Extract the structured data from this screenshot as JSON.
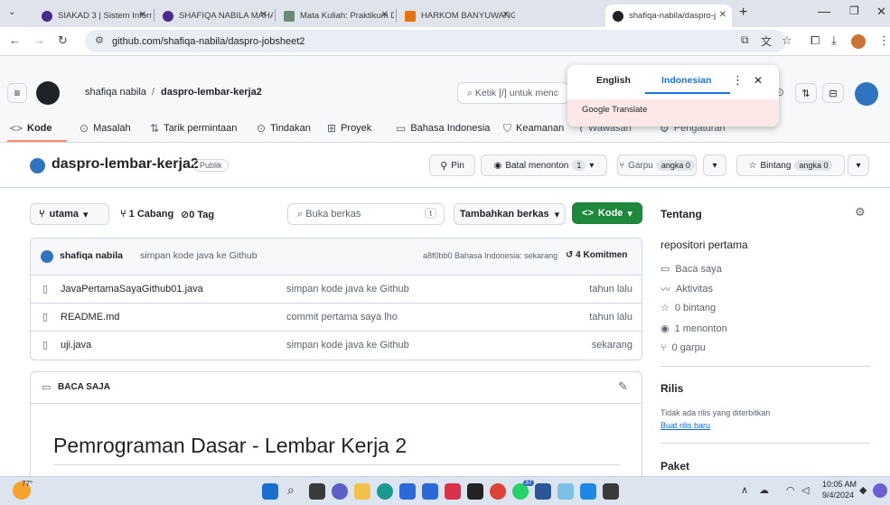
{
  "browser": {
    "tabs": [
      {
        "title": "SIAKAD 3 | Sistem Inform",
        "color": "#4a2a8a"
      },
      {
        "title": "SHAFIQA NABILA MAHA",
        "color": "#4a2a8a"
      },
      {
        "title": "Mata Kuliah: Praktikum D",
        "color": "#6d8b74"
      },
      {
        "title": "HARKOM BANYUWANGI",
        "color": "#e8710a"
      },
      {
        "title": "shafiqa-nabila/daspro-jo",
        "color": "#1f2328"
      }
    ],
    "url": "github.com/shafiqa-nabila/daspro-jobsheet2"
  },
  "translate": {
    "tab_english": "English",
    "tab_indonesian": "Indonesian",
    "footer": "Google Translate"
  },
  "header": {
    "owner": "shafiqa nabila",
    "sep": "/",
    "repo": "daspro-lembar-kerja2",
    "search_placeholder": "Ketik [/] untuk menc"
  },
  "nav": {
    "kode": "Kode",
    "masalah": "Masalah",
    "tarik": "Tarik permintaan",
    "tindakan": "Tindakan",
    "proyek": "Proyek",
    "bahasa": "Bahasa Indonesia",
    "keamanan": "Keamanan",
    "wawasan": "Wawasan",
    "pengaturan": "Pengaturan"
  },
  "repo": {
    "name": "daspro-lembar-kerja2",
    "visibility": "Publik",
    "pin": "Pin",
    "unwatch": "Batal menonton",
    "watch_count": "1",
    "fork": "Garpu",
    "fork_count": "angka 0",
    "star": "Bintang",
    "star_count": "angka 0"
  },
  "toolbar": {
    "branch": "utama",
    "branches": "1 Cabang",
    "tags": "0 Tag",
    "find_placeholder": "Buka berkas",
    "find_key": "t",
    "add_file": "Tambahkan berkas",
    "code": "Kode"
  },
  "commit": {
    "author": "shafiqa nabila",
    "message": "simpan kode java ke Github",
    "meta": "a8f0bb0 Bahasa Indonesia: sekarang",
    "commits": "4 Komitmen"
  },
  "files": [
    {
      "name": "JavaPertamaSayaGithub01.java",
      "msg": "simpan kode java ke Github",
      "time": "tahun lalu"
    },
    {
      "name": "README.md",
      "msg": "commit pertama saya lho",
      "time": "tahun lalu"
    },
    {
      "name": "uji.java",
      "msg": "simpan kode java ke Github",
      "time": "sekarang"
    }
  ],
  "readme": {
    "label": "BACA SAJA",
    "heading": "Pemrograman Dasar - Lembar Kerja 2"
  },
  "about": {
    "title": "Tentang",
    "desc": "repositori pertama",
    "readme": "Baca saya",
    "activity": "Aktivitas",
    "stars": "0 bintang",
    "watching": "1 menonton",
    "forks": "0 garpu"
  },
  "releases": {
    "title": "Rilis",
    "none": "Tidak ada rilis yang diterbitkan",
    "create": "Buat rilis baru"
  },
  "packages": {
    "title": "Paket"
  },
  "taskbar": {
    "weather": "77°",
    "time": "10:05 AM",
    "date": "9/4/2024",
    "badge": "37"
  }
}
